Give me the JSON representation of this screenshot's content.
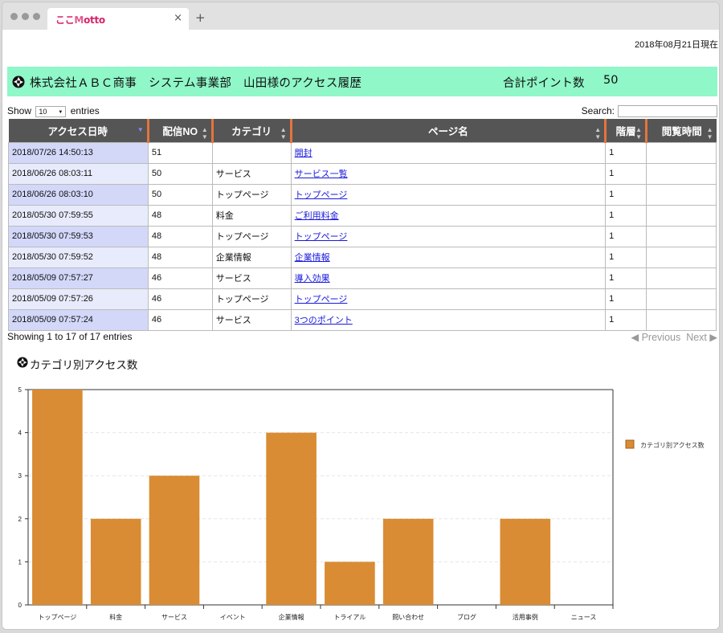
{
  "browser": {
    "tab_logo_pre": "ここ",
    "tab_logo_m": "M",
    "tab_logo_post": "otto",
    "tab_close": "×",
    "new_tab": "+"
  },
  "header": {
    "date": "2018年08月21日現在",
    "title": "株式会社ＡＢＣ商事　システム事業部　山田様のアクセス履歴",
    "points_label": "合計ポイント数",
    "points_value": "50"
  },
  "table_controls": {
    "show_label": "Show",
    "entries_value": "10",
    "entries_label": "entries",
    "search_label": "Search:"
  },
  "table": {
    "columns": [
      "アクセス日時",
      "配信NO",
      "カテゴリ",
      "ページ名",
      "階層",
      "閲覧時間"
    ],
    "rows": [
      [
        "2018/07/26 14:50:13",
        "51",
        "",
        "開封",
        "1",
        ""
      ],
      [
        "2018/06/26 08:03:11",
        "50",
        "サービス",
        "サービス一覧",
        "1",
        ""
      ],
      [
        "2018/06/26 08:03:10",
        "50",
        "トップページ",
        "トップページ",
        "1",
        ""
      ],
      [
        "2018/05/30 07:59:55",
        "48",
        "料金",
        "ご利用料金",
        "1",
        ""
      ],
      [
        "2018/05/30 07:59:53",
        "48",
        "トップページ",
        "トップページ",
        "1",
        ""
      ],
      [
        "2018/05/30 07:59:52",
        "48",
        "企業情報",
        "企業情報",
        "1",
        ""
      ],
      [
        "2018/05/09 07:57:27",
        "46",
        "サービス",
        "導入効果",
        "1",
        ""
      ],
      [
        "2018/05/09 07:57:26",
        "46",
        "トップページ",
        "トップページ",
        "1",
        ""
      ],
      [
        "2018/05/09 07:57:24",
        "46",
        "サービス",
        "3つのポイント",
        "1",
        ""
      ]
    ],
    "info": "Showing 1 to 17 of 17 entries",
    "prev_label": "Previous",
    "next_label": "Next"
  },
  "chart_section": {
    "title": "カテゴリ別アクセス数"
  },
  "colors": {
    "header_bg": "#8ff7c8",
    "table_header_bg": "#555555",
    "table_header_accent": "#e4743d",
    "bar": "#d98c33"
  },
  "chart_data": {
    "type": "bar",
    "categories": [
      "トップページ",
      "料金",
      "サービス",
      "イベント",
      "企業情報",
      "トライアル",
      "問い合わせ",
      "ブログ",
      "活用事例",
      "ニュース"
    ],
    "series": [
      {
        "name": "カテゴリ別アクセス数",
        "values": [
          5,
          2,
          3,
          0,
          4,
          1,
          2,
          0,
          2,
          0
        ]
      }
    ],
    "ylim": [
      0,
      5
    ],
    "yticks": [
      0,
      1,
      2,
      3,
      4,
      5
    ],
    "grid": true,
    "legend": "right"
  }
}
